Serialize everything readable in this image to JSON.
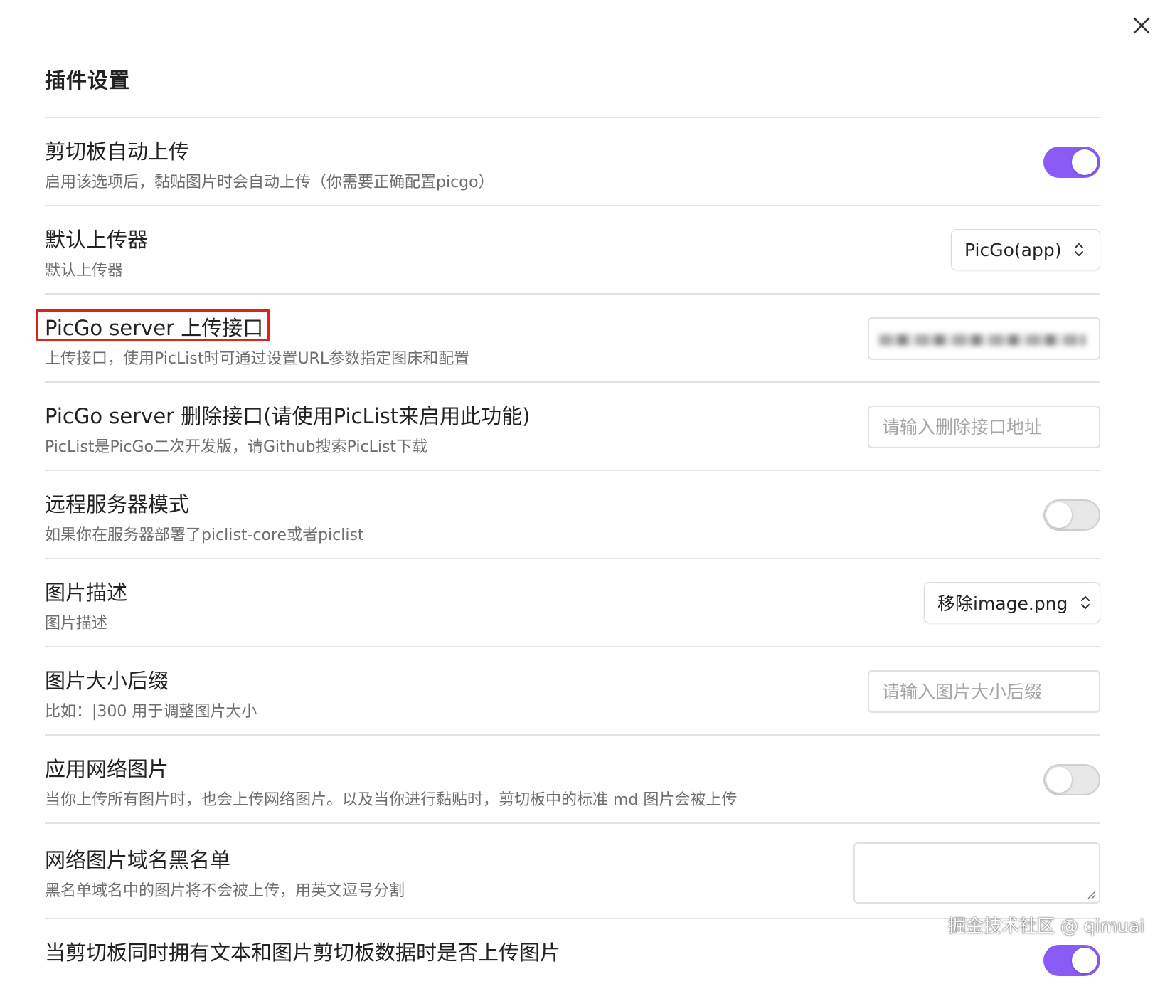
{
  "modal": {
    "title": "插件设置",
    "close_icon": "close-icon"
  },
  "settings": [
    {
      "name": "剪切板自动上传",
      "desc": "启用该选项后，黏贴图片时会自动上传（你需要正确配置picgo）",
      "control": "toggle",
      "on": true
    },
    {
      "name": "默认上传器",
      "desc": "默认上传器",
      "control": "dropdown",
      "selected": "PicGo(app)"
    },
    {
      "name": "PicGo server 上传接口",
      "desc": "上传接口，使用PicList时可通过设置URL参数指定图床和配置",
      "control": "text-input-blurred",
      "highlighted": true
    },
    {
      "name": "PicGo server 删除接口(请使用PicList来启用此功能)",
      "desc": "PicList是PicGo二次开发版，请Github搜索PicList下载",
      "control": "text-input",
      "placeholder": "请输入删除接口地址"
    },
    {
      "name": "远程服务器模式",
      "desc": "如果你在服务器部署了piclist-core或者piclist",
      "control": "toggle",
      "on": false
    },
    {
      "name": "图片描述",
      "desc": "图片描述",
      "control": "dropdown",
      "selected": "移除image.png"
    },
    {
      "name": "图片大小后缀",
      "desc": "比如：|300 用于调整图片大小",
      "control": "text-input",
      "placeholder": "请输入图片大小后缀"
    },
    {
      "name": "应用网络图片",
      "desc": "当你上传所有图片时，也会上传网络图片。以及当你进行黏贴时，剪切板中的标准 md 图片会被上传",
      "control": "toggle",
      "on": false
    },
    {
      "name": "网络图片域名黑名单",
      "desc": "黑名单域名中的图片将不会被上传，用英文逗号分割",
      "control": "textarea",
      "value": ""
    },
    {
      "name": "当剪切板同时拥有文本和图片剪切板数据时是否上传图片",
      "desc": "",
      "control": "toggle",
      "on": true
    }
  ],
  "watermark": "掘金技术社区 @ qimuai",
  "colors": {
    "accent": "#8a5cf5",
    "highlight_border": "#e3201b",
    "toggle_off": "#e7e7e7"
  }
}
